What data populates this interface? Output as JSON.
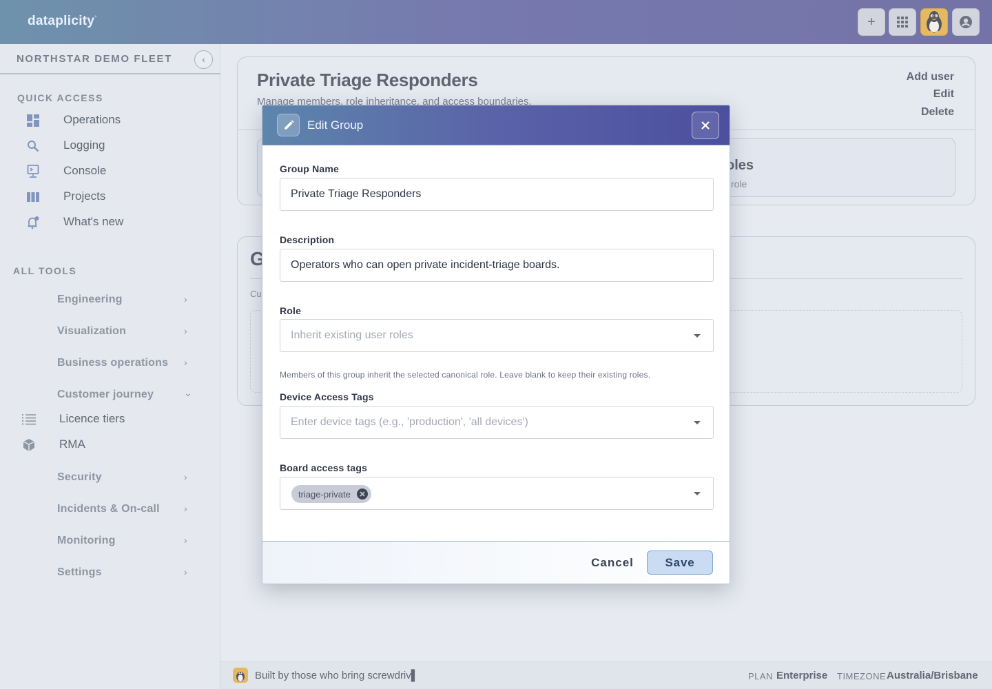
{
  "app": {
    "brand": "dataplicity",
    "brand_mark": "°"
  },
  "topbar": {
    "add_icon": "+",
    "apps_icon": "grid-icon",
    "avatar_icon": "tux-avatar-icon",
    "account_icon": "account-icon"
  },
  "sidebar": {
    "fleet_name": "NORTHSTAR DEMO FLEET",
    "quick_access_title": "QUICK ACCESS",
    "quick_access": [
      {
        "label": "Operations",
        "icon": "dashboard-icon"
      },
      {
        "label": "Logging",
        "icon": "search-icon"
      },
      {
        "label": "Console",
        "icon": "console-icon"
      },
      {
        "label": "Projects",
        "icon": "columns-icon"
      },
      {
        "label": "What's new",
        "icon": "bell-icon"
      }
    ],
    "all_tools_title": "ALL TOOLS",
    "tools": [
      {
        "label": "Engineering",
        "expanded": false
      },
      {
        "label": "Visualization",
        "expanded": false
      },
      {
        "label": "Business operations",
        "expanded": false
      },
      {
        "label": "Customer journey",
        "expanded": true
      },
      {
        "label": "Security",
        "expanded": false
      },
      {
        "label": "Incidents & On-call",
        "expanded": false
      },
      {
        "label": "Monitoring",
        "expanded": false
      },
      {
        "label": "Settings",
        "expanded": false
      }
    ],
    "customer_journey_items": [
      {
        "label": "Licence tiers",
        "icon": "list-icon"
      },
      {
        "label": "RMA",
        "icon": "box-icon"
      }
    ]
  },
  "main": {
    "group_card": {
      "title": "Private Triage Responders",
      "subtitle": "Manage members, role inheritance, and access boundaries.",
      "actions": [
        "Add user",
        "Edit",
        "Delete"
      ],
      "roles_fragment_title": "oles",
      "roles_fragment_sub": "l role"
    },
    "second_card": {
      "title_fragment": "G",
      "sub_fragment": "Cu"
    }
  },
  "modal": {
    "title": "Edit Group",
    "fields": {
      "group_name": {
        "label": "Group Name",
        "value": "Private Triage Responders"
      },
      "description": {
        "label": "Description",
        "value": "Operators who can open private incident-triage boards."
      },
      "role": {
        "label": "Role",
        "placeholder": "Inherit existing user roles",
        "hint": "Members of this group inherit the selected canonical role. Leave blank to keep their existing roles."
      },
      "device_tags": {
        "label": "Device Access Tags",
        "placeholder": "Enter device tags (e.g., 'production', 'all devices')"
      },
      "board_tags": {
        "label": "Board access tags",
        "chips": [
          "triage-private"
        ]
      }
    },
    "cancel_label": "Cancel",
    "save_label": "Save"
  },
  "footer": {
    "built_by": "Built by those who bring screwdriv▌",
    "plan_key": "PLAN",
    "plan_value": "Enterprise",
    "timezone_key": "TIMEZONE",
    "timezone_value": "Australia/Brisbane"
  },
  "colors": {
    "accent": "#4a4e94",
    "save_bg": "#c9dcf4",
    "chip_bg": "#c7ccd6"
  }
}
